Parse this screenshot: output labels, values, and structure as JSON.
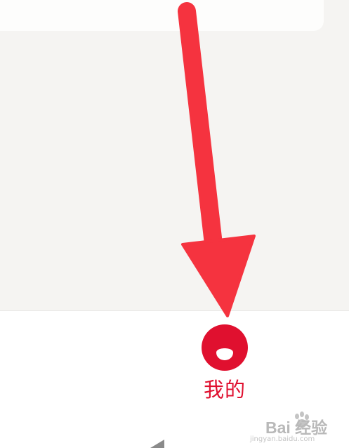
{
  "bottom_nav": {
    "me_tab": {
      "label": "我的",
      "icon": "smiley-face-icon",
      "color": "#e0102f"
    }
  },
  "annotation": {
    "arrow_color": "#f5333f",
    "icon": "arrow-down-icon"
  },
  "watermark": {
    "text": "Bai 经验",
    "icon": "paw-icon",
    "url_text": "jingyan.baidu.com"
  }
}
